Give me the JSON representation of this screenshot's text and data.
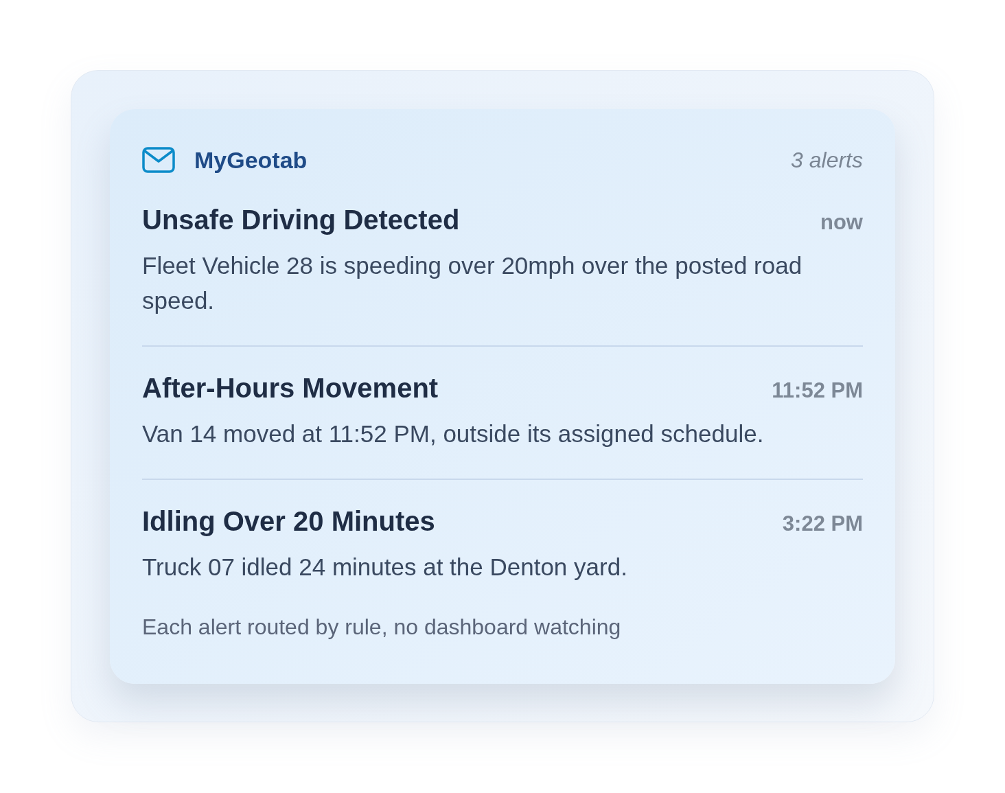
{
  "header": {
    "app_name": "MyGeotab",
    "alert_count": "3 alerts"
  },
  "alerts": [
    {
      "title": "Unsafe Driving Detected",
      "time": "now",
      "message": "Fleet Vehicle 28 is speeding over 20mph over the posted road speed."
    },
    {
      "title": "After-Hours Movement",
      "time": "11:52 PM",
      "message": "Van 14 moved at 11:52 PM, outside its assigned schedule."
    },
    {
      "title": "Idling Over 20 Minutes",
      "time": "3:22 PM",
      "message": "Truck 07 idled 24 minutes at the Denton yard."
    }
  ],
  "footer": "Each alert routed by rule, no dashboard watching"
}
